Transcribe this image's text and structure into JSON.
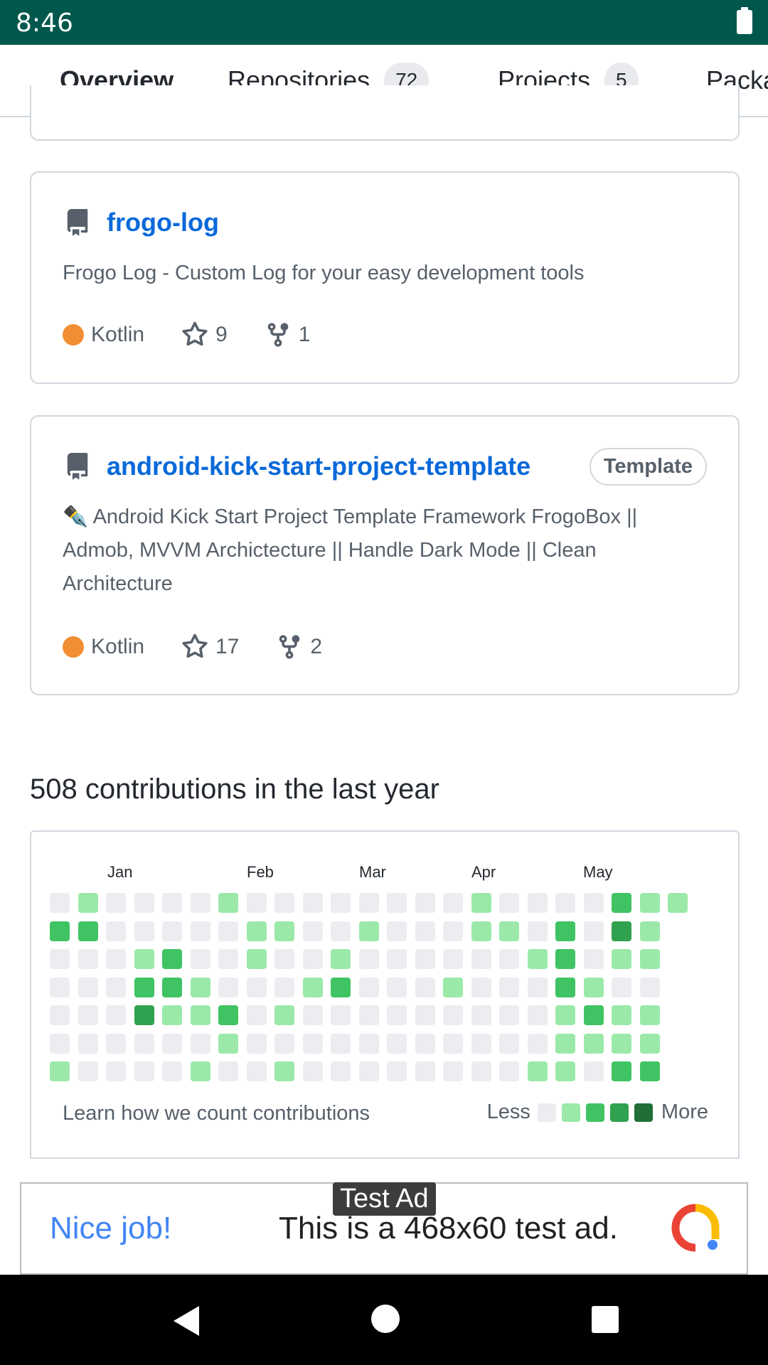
{
  "status_bar": {
    "time": "8:46"
  },
  "tabs": [
    {
      "label": "Overview",
      "active": true
    },
    {
      "label": "Repositories",
      "count": "72"
    },
    {
      "label": "Projects",
      "count": "5"
    },
    {
      "label": "Packages"
    }
  ],
  "repos": [
    {
      "name": "frogo-log",
      "description": "Frogo Log - Custom Log for your easy development tools",
      "language": "Kotlin",
      "stars": "9",
      "forks": "1"
    },
    {
      "name": "android-kick-start-project-template",
      "badge": "Template",
      "description": "✒️ Android Kick Start Project Template Framework FrogoBox || Admob, MVVM Archictecture || Handle Dark Mode || Clean Architecture",
      "language": "Kotlin",
      "stars": "17",
      "forks": "2"
    }
  ],
  "contributions": {
    "title": "508 contributions in the last year",
    "months": [
      "Jan",
      "Feb",
      "Mar",
      "Apr",
      "May"
    ],
    "learn_text": "Learn how we count contributions",
    "legend_less": "Less",
    "legend_more": "More",
    "colors": [
      "#ebedf0",
      "#9be9a8",
      "#40c463",
      "#30a14e",
      "#216e39"
    ],
    "weeks": [
      [
        0,
        2,
        0,
        0,
        0,
        0,
        1
      ],
      [
        1,
        2,
        0,
        0,
        0,
        0,
        0
      ],
      [
        0,
        0,
        0,
        0,
        0,
        0,
        0
      ],
      [
        0,
        0,
        1,
        2,
        3,
        0,
        0
      ],
      [
        0,
        0,
        2,
        2,
        1,
        0,
        0
      ],
      [
        0,
        0,
        0,
        1,
        1,
        0,
        1
      ],
      [
        1,
        0,
        0,
        0,
        2,
        1,
        0
      ],
      [
        0,
        1,
        1,
        0,
        0,
        0,
        0
      ],
      [
        0,
        1,
        0,
        0,
        1,
        0,
        1
      ],
      [
        0,
        0,
        0,
        1,
        0,
        0,
        0
      ],
      [
        0,
        0,
        1,
        2,
        0,
        0,
        0
      ],
      [
        0,
        1,
        0,
        0,
        0,
        0,
        0
      ],
      [
        0,
        0,
        0,
        0,
        0,
        0,
        0
      ],
      [
        0,
        0,
        0,
        0,
        0,
        0,
        0
      ],
      [
        0,
        0,
        0,
        1,
        0,
        0,
        0
      ],
      [
        1,
        1,
        0,
        0,
        0,
        0,
        0
      ],
      [
        0,
        1,
        0,
        0,
        0,
        0,
        0
      ],
      [
        0,
        0,
        1,
        0,
        0,
        0,
        1
      ],
      [
        0,
        2,
        2,
        2,
        1,
        1,
        1
      ],
      [
        0,
        0,
        0,
        1,
        2,
        1,
        0
      ],
      [
        2,
        3,
        1,
        0,
        1,
        1,
        2
      ],
      [
        1,
        1,
        1,
        0,
        1,
        1,
        2
      ],
      [
        1,
        null,
        null,
        null,
        null,
        null,
        null
      ]
    ]
  },
  "ad": {
    "label": "Test Ad",
    "nice": "Nice job!",
    "text": "This is a 468x60 test ad."
  }
}
